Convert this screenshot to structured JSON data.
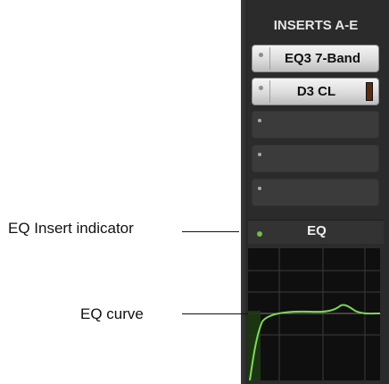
{
  "inserts": {
    "title": "INSERTS A-E",
    "slots": [
      {
        "label": "EQ3 7-Band",
        "filled": true
      },
      {
        "label": "D3 CL",
        "filled": true
      },
      {
        "label": "",
        "filled": false
      },
      {
        "label": "",
        "filled": false
      },
      {
        "label": "",
        "filled": false
      }
    ]
  },
  "eq": {
    "label": "EQ",
    "indicator_color": "#6cc04a",
    "curve_color": "#7ed957"
  },
  "callouts": {
    "insert_indicator": "EQ Insert indicator",
    "curve": "EQ curve"
  }
}
